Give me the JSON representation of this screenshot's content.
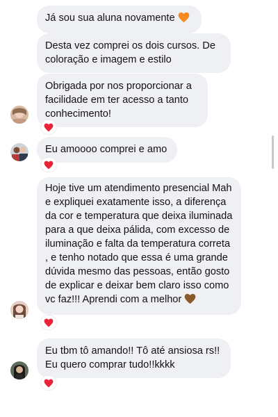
{
  "messages": [
    {
      "text": "Já sou sua aluna novamente",
      "emoji": "orange-heart-icon",
      "reaction": null
    },
    {
      "text": "Desta vez comprei os dois cursos. De coloração e imagem e estilo",
      "reaction": null
    },
    {
      "text": "Obrigada por nos proporcionar a facilidade em ter acesso a tanto conhecimento!",
      "reaction": "red-heart-icon"
    },
    {
      "text": "Eu amoooo comprei e amo",
      "reaction": "red-heart-icon"
    },
    {
      "text": "Hoje tive um atendimento presencial Mah e expliquei exatamente isso, a diferença da cor e temperatura que deixa iluminada para a que deixa pálida, com excesso de iluminação e falta da temperatura correta , e tenho notado que essa é uma grande dúvida mesmo das pessoas, então gosto de explicar e deixar bem claro isso como vc faz!!! Aprendi com a melhor",
      "emoji": "brown-heart-icon",
      "reaction": "red-heart-icon"
    },
    {
      "text": "Eu tbm tô amando!! Tô até ansiosa rs!! Eu quero comprar tudo!!kkkk",
      "reaction": "red-heart-icon"
    }
  ],
  "colors": {
    "bubble": "#eff0f3",
    "text": "#111111",
    "reaction_heart": "#e8243b",
    "orange_heart": "#f58a1f",
    "brown_heart": "#8a5a2b"
  }
}
